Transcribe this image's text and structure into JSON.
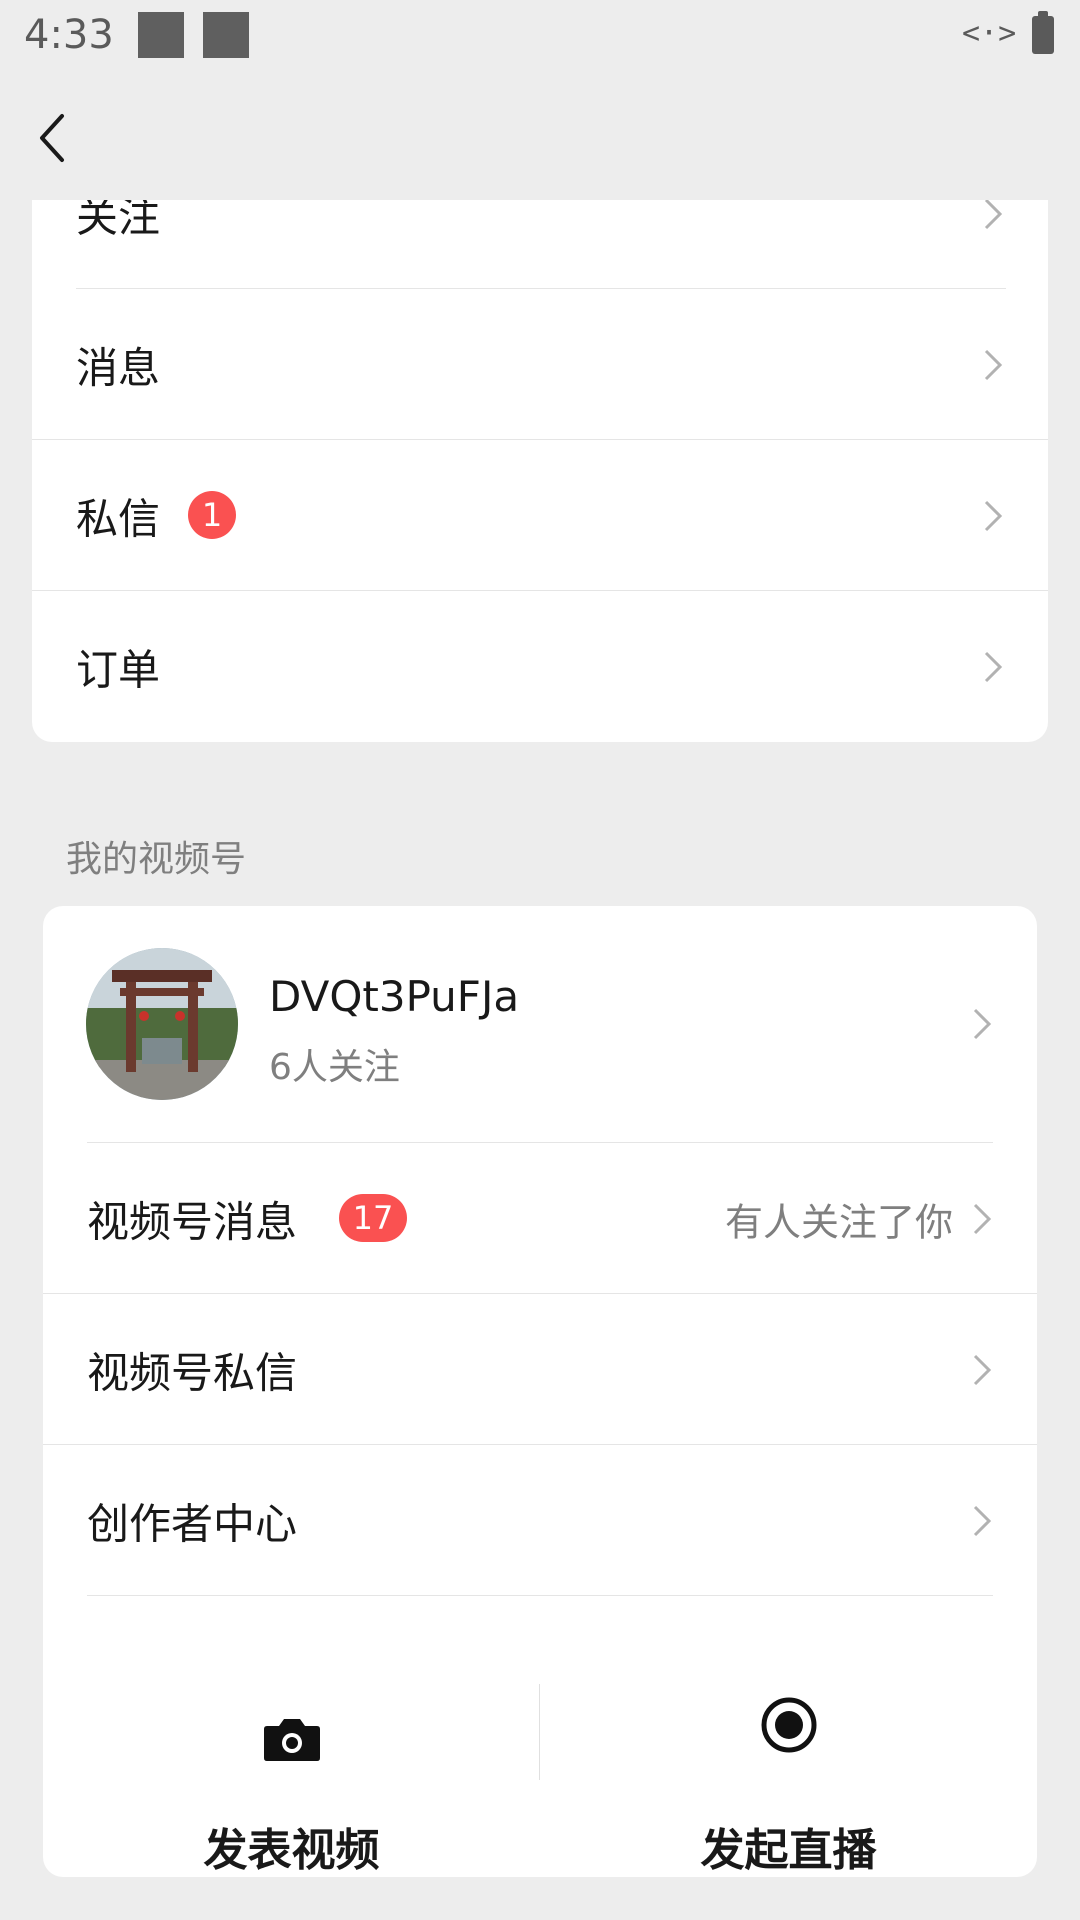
{
  "status_bar": {
    "time": "4:33",
    "link_icon": "<·>"
  },
  "nav": {
    "back_icon": "chevron-left-icon"
  },
  "menu": {
    "items": [
      {
        "label": "关注"
      },
      {
        "label": "消息"
      },
      {
        "label": "私信",
        "badge": "1"
      },
      {
        "label": "订单"
      }
    ]
  },
  "channels_section": {
    "title": "我的视频号",
    "profile": {
      "name": "DVQt3PuFJa",
      "followers": "6人关注"
    },
    "items": [
      {
        "label": "视频号消息",
        "badge": "17",
        "hint": "有人关注了你"
      },
      {
        "label": "视频号私信"
      },
      {
        "label": "创作者中心"
      }
    ],
    "actions": [
      {
        "label": "发表视频",
        "icon": "camera-icon"
      },
      {
        "label": "发起直播",
        "icon": "live-record-icon"
      }
    ]
  },
  "colors": {
    "badge": "#fa5151",
    "background": "#ededed",
    "card": "#ffffff"
  }
}
